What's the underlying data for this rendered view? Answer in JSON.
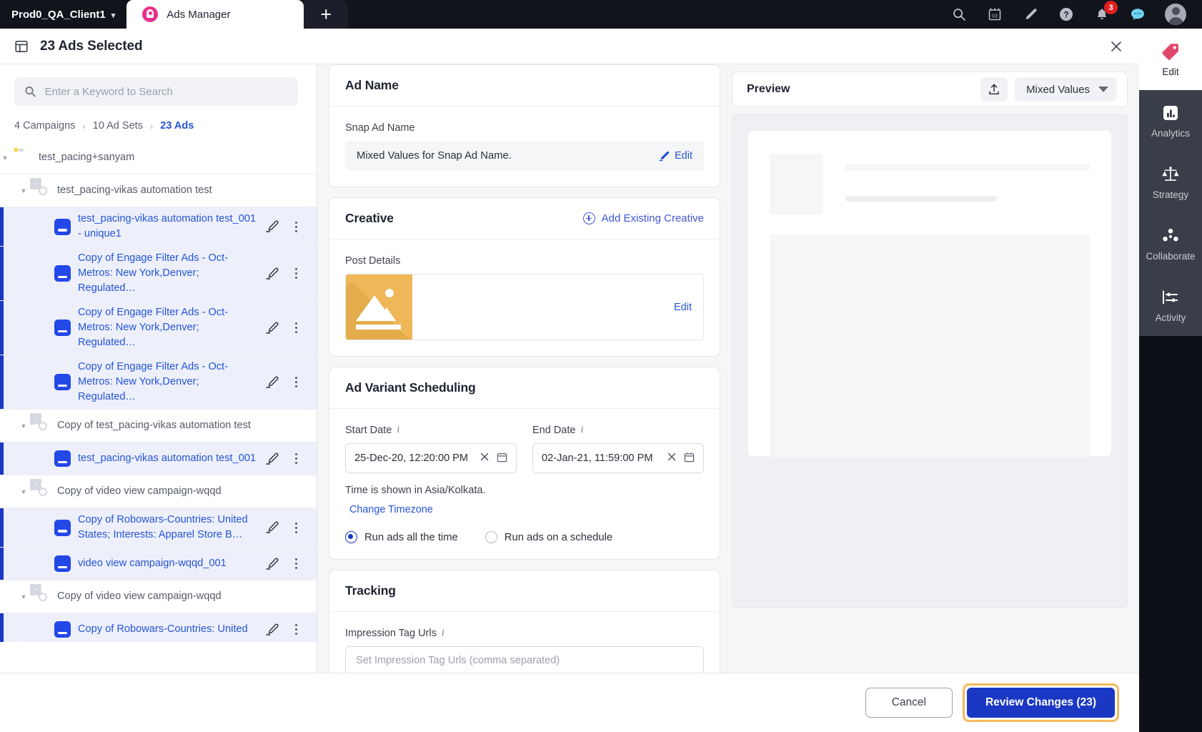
{
  "topbar": {
    "account": "Prod0_QA_Client1",
    "account_caret": "▾",
    "tab_label": "Ads Manager",
    "new_tab_label": "+",
    "icons": [
      {
        "name": "search-icon"
      },
      {
        "name": "calendar-icon",
        "text": "03"
      },
      {
        "name": "pencil-icon"
      },
      {
        "name": "help-icon"
      },
      {
        "name": "bell-icon",
        "badge": "3"
      },
      {
        "name": "chat-icon"
      },
      {
        "name": "avatar"
      }
    ],
    "notification_count": "3",
    "calendar_day": "03"
  },
  "subheader": {
    "title": "23 Ads Selected",
    "layout_icon": "layout-icon",
    "close_icon": "close-icon"
  },
  "sidebar": {
    "search_placeholder": "Enter a Keyword to Search",
    "search_value": "",
    "breadcrumb": {
      "campaigns": "4 Campaigns",
      "adsets": "10 Ad Sets",
      "ads": "23 Ads",
      "separator": "›"
    },
    "tree": [
      {
        "type": "campaign",
        "indent": 0,
        "label": "test_pacing+sanyam",
        "selected": false,
        "expanded": true
      },
      {
        "type": "adset",
        "indent": 1,
        "label": "test_pacing-vikas automation test",
        "selected": false,
        "expanded": true
      },
      {
        "type": "ad",
        "indent": 2,
        "label": "test_pacing-vikas automation test_001 - unique1",
        "selected": true
      },
      {
        "type": "ad",
        "indent": 2,
        "label": "Copy of Engage Filter Ads - Oct-Metros: New York,Denver; Regulated…",
        "selected": true
      },
      {
        "type": "ad",
        "indent": 2,
        "label": "Copy of Engage Filter Ads - Oct-Metros: New York,Denver; Regulated…",
        "selected": true
      },
      {
        "type": "ad",
        "indent": 2,
        "label": "Copy of Engage Filter Ads - Oct-Metros: New York,Denver; Regulated…",
        "selected": true
      },
      {
        "type": "adset",
        "indent": 1,
        "label": "Copy of test_pacing-vikas automation test",
        "selected": false,
        "expanded": true
      },
      {
        "type": "ad",
        "indent": 2,
        "label": "test_pacing-vikas automation test_001",
        "selected": true
      },
      {
        "type": "adset",
        "indent": 1,
        "label": "Copy of video view campaign-wqqd",
        "selected": false,
        "expanded": true
      },
      {
        "type": "ad",
        "indent": 2,
        "label": "Copy of Robowars-Countries: United States; Interests: Apparel Store B…",
        "selected": true
      },
      {
        "type": "ad",
        "indent": 2,
        "label": "video view campaign-wqqd_001",
        "selected": true
      },
      {
        "type": "adset",
        "indent": 1,
        "label": "Copy of video view campaign-wqqd",
        "selected": false,
        "expanded": true
      },
      {
        "type": "ad",
        "indent": 2,
        "label": "Copy of Robowars-Countries: United",
        "selected": true
      }
    ]
  },
  "main": {
    "ad_name": {
      "title": "Ad Name",
      "field_label": "Snap Ad Name",
      "field_value": "Mixed Values for Snap Ad Name.",
      "edit_label": "Edit"
    },
    "creative": {
      "title": "Creative",
      "add_existing_label": "Add Existing Creative",
      "post_details_label": "Post Details",
      "post_edit_label": "Edit"
    },
    "scheduling": {
      "title": "Ad Variant Scheduling",
      "start_label": "Start Date",
      "start_value": "25-Dec-20, 12:20:00 PM",
      "end_label": "End Date",
      "end_value": "02-Jan-21, 11:59:00 PM",
      "timezone_note": "Time is shown in Asia/Kolkata.",
      "change_timezone_label": "Change Timezone",
      "radio_all_time": "Run ads all the time",
      "radio_schedule": "Run ads on a schedule",
      "radio_selected": "Run ads all the time"
    },
    "tracking": {
      "title": "Tracking",
      "impression_label": "Impression Tag Urls",
      "impression_placeholder": "Set Impression Tag Urls (comma separated)"
    }
  },
  "preview": {
    "title": "Preview",
    "upload_icon": "upload-icon",
    "select_value": "Mixed Values"
  },
  "rail": [
    {
      "label": "Edit",
      "icon": "tag-icon",
      "active": true
    },
    {
      "label": "Analytics",
      "icon": "bar-chart-icon",
      "active": false
    },
    {
      "label": "Strategy",
      "icon": "scales-icon",
      "active": false
    },
    {
      "label": "Collaborate",
      "icon": "people-icon",
      "active": false
    },
    {
      "label": "Activity",
      "icon": "activity-icon",
      "active": false
    }
  ],
  "footer": {
    "cancel_label": "Cancel",
    "review_label": "Review Changes (23)"
  },
  "colors": {
    "accent_blue": "#1a38c4",
    "link_blue": "#2555d6",
    "highlight_orange": "#f5b95c",
    "badge_red": "#e02020",
    "dark": "#0e1017",
    "thumb_yellow": "#efb758"
  }
}
